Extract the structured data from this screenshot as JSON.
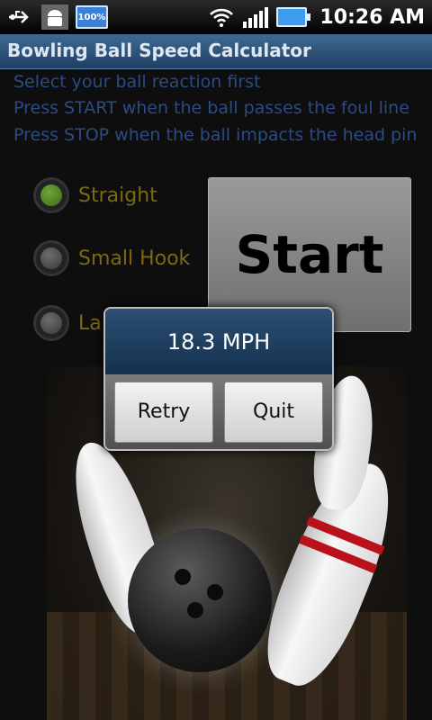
{
  "status_bar": {
    "icons": [
      "usb-icon",
      "android-debug-icon",
      "battery-percent-icon",
      "wifi-icon",
      "signal-icon",
      "battery-icon"
    ],
    "battery_badge": "100%",
    "time": "10:26 AM"
  },
  "app": {
    "title": "Bowling Ball Speed Calculator"
  },
  "instructions": [
    "Select your ball reaction first",
    "Press START when the ball passes the foul line",
    "Press STOP when the ball impacts the head pin"
  ],
  "reactions": {
    "selected": "Straight",
    "options": [
      {
        "label": "Straight"
      },
      {
        "label": "Small Hook"
      },
      {
        "label": "La"
      }
    ]
  },
  "start_button": {
    "label": "Start"
  },
  "dialog": {
    "result": "18.3 MPH",
    "retry_label": "Retry",
    "quit_label": "Quit"
  },
  "colors": {
    "title_bar": "#2c557d",
    "instruction_text": "#2b4a86",
    "radio_label": "#7a6a10",
    "selected_radio": "#5f9a2f"
  }
}
